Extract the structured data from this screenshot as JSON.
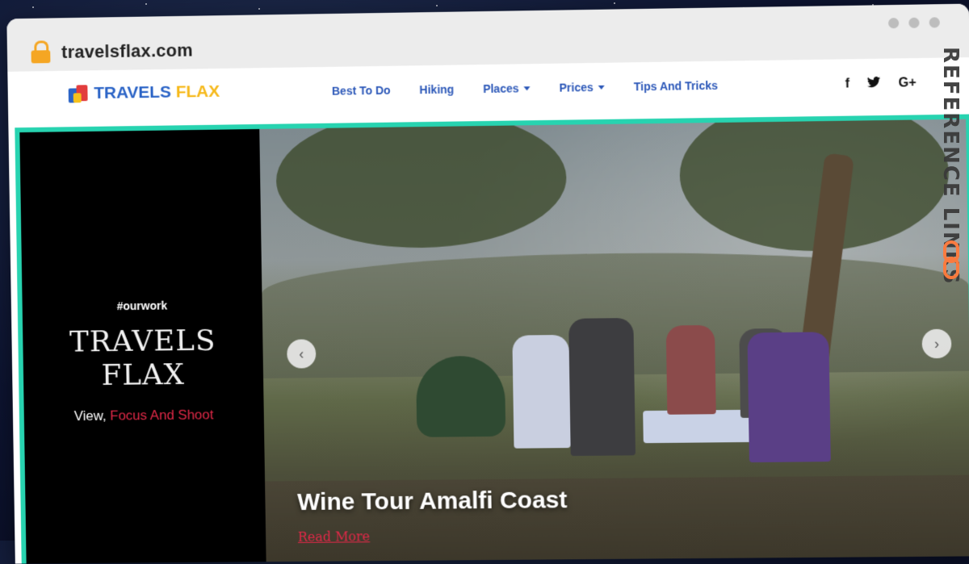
{
  "browser": {
    "url": "travelsflax.com"
  },
  "logo": {
    "part1": "TRAVELS",
    "part2": "FLAX"
  },
  "nav": {
    "items": [
      {
        "label": "Best To Do",
        "dropdown": false
      },
      {
        "label": "Hiking",
        "dropdown": false
      },
      {
        "label": "Places",
        "dropdown": true
      },
      {
        "label": "Prices",
        "dropdown": true
      },
      {
        "label": "Tips And Tricks",
        "dropdown": false
      }
    ],
    "social": [
      "f",
      "t",
      "G+"
    ]
  },
  "hero_panel": {
    "tag": "#ourwork",
    "title_line1": "TRAVELS",
    "title_line2": "FLAX",
    "sub_plain": "View,",
    "sub_highlight": "Focus And Shoot"
  },
  "slide": {
    "title": "Wine Tour Amalfi Coast",
    "read_more": "Read More"
  },
  "watermark": {
    "text": "REFERENCE LINKS"
  },
  "colors": {
    "accent_teal": "#27d3b0",
    "brand_blue": "#2a63c6",
    "brand_yellow": "#f6b91b",
    "highlight_red": "#e02847",
    "lock_orange": "#f5a623"
  }
}
